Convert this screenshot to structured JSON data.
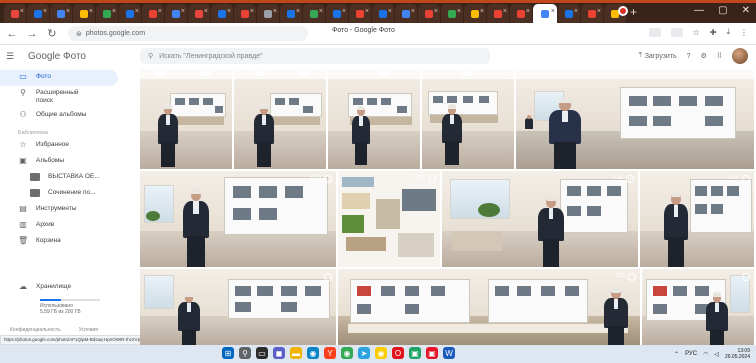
{
  "browser": {
    "tab_count": 27,
    "active_tab_index": 23,
    "tab_favicon_colors": [
      "#e8453c",
      "#1a73e8",
      "#4285f4",
      "#fbbc04",
      "#34a853",
      "#1a73e8",
      "#ea4335",
      "#4285f4",
      "#e8453c",
      "#1a73e8",
      "#ea4335",
      "#9aa0a6",
      "#1a73e8",
      "#34a853",
      "#1a73e8",
      "#ea4335",
      "#1a73e8",
      "#4285f4",
      "#ea4335",
      "#34a853",
      "#fbbc04",
      "#ea4335",
      "#ea4335",
      "#ffffff",
      "#1a73e8",
      "#ea4335",
      "#fbbc04"
    ],
    "url": "photos.google.com",
    "page_title": "Фото - Google Фото",
    "nav": {
      "back_icon": "arrow-left-icon",
      "forward_icon": "arrow-right-icon",
      "reload_icon": "reload-icon"
    },
    "status_url": "https://photos.google.com/photo/AF1QipM-Bdsaq-HpnOWtR-Ihz2VpkWfv2nPfa"
  },
  "app": {
    "logo_text": "Google Фото",
    "search_placeholder": "Искать \"Ленинградской правде\"",
    "upload_label": "Загрузить",
    "accent_color": "#1a73e8",
    "active_bg": "#e8f0fe"
  },
  "sidebar": {
    "items": [
      {
        "icon": "photo-icon",
        "label": "Фото",
        "active": true
      },
      {
        "icon": "search-icon",
        "label": "Расширенный поиск",
        "active": false
      },
      {
        "icon": "people-icon",
        "label": "Общие альбомы",
        "active": false
      }
    ],
    "section_label": "Библиотека",
    "library": [
      {
        "icon": "star-icon",
        "label": "Избранное"
      },
      {
        "icon": "album-icon",
        "label": "Альбомы"
      }
    ],
    "albums": [
      {
        "label": "ВЫСТАВКА ОЕ..."
      },
      {
        "label": "Сочинение по..."
      }
    ],
    "tools": [
      {
        "icon": "tools-icon",
        "label": "Инструменты"
      },
      {
        "icon": "archive-icon",
        "label": "Архив"
      },
      {
        "icon": "trash-icon",
        "label": "Корзина"
      }
    ],
    "storage": {
      "label": "Хранилище",
      "used_text": "Использовано",
      "detail": "5,59 ГБ из 200 ГБ"
    },
    "footer": [
      "Конфиденциальность",
      "Условия"
    ]
  },
  "photos": [
    {
      "row": 0,
      "kind": "hall-a",
      "has_man": true
    },
    {
      "row": 0,
      "kind": "hall-a",
      "has_man": true
    },
    {
      "row": 0,
      "kind": "hall-a",
      "has_man": true
    },
    {
      "row": 0,
      "kind": "hall-a",
      "has_man": true
    },
    {
      "row": 0,
      "kind": "hall-b",
      "has_man": true
    },
    {
      "row": 1,
      "kind": "hall-c",
      "has_man": true
    },
    {
      "row": 1,
      "kind": "hall-d",
      "has_man": false
    },
    {
      "row": 1,
      "kind": "hall-e",
      "has_man": true
    },
    {
      "row": 1,
      "kind": "hall-f",
      "has_man": true
    },
    {
      "row": 2,
      "kind": "hall-g",
      "has_man": true
    },
    {
      "row": 2,
      "kind": "hall-h",
      "has_man": false
    },
    {
      "row": 2,
      "kind": "hall-i",
      "has_man": true
    },
    {
      "row": 2,
      "kind": "hall-j",
      "has_man": true
    }
  ],
  "video_durations": [
    "0:05",
    "0:46",
    "0:30",
    "0:06",
    "0:35"
  ],
  "taskbar": {
    "icons": [
      {
        "name": "windows-start-icon",
        "color": "#0067c0",
        "glyph": "⊞"
      },
      {
        "name": "search-icon",
        "color": "#5f6368",
        "glyph": "⚲"
      },
      {
        "name": "taskview-icon",
        "color": "#2b2b2b",
        "glyph": "▭"
      },
      {
        "name": "chat-icon",
        "color": "#5b5fc7",
        "glyph": "◼"
      },
      {
        "name": "explorer-icon",
        "color": "#f0b400",
        "glyph": "▬"
      },
      {
        "name": "edge-icon",
        "color": "#0a84c7",
        "glyph": "◉"
      },
      {
        "name": "yandex-icon",
        "color": "#fc3f1d",
        "glyph": "Y"
      },
      {
        "name": "chrome-icon",
        "color": "#34a853",
        "glyph": "◉"
      },
      {
        "name": "telegram-icon",
        "color": "#2aa3df",
        "glyph": "➤"
      },
      {
        "name": "yandex-browser-icon",
        "color": "#ffcc00",
        "glyph": "◉"
      },
      {
        "name": "opera-icon",
        "color": "#e3131b",
        "glyph": "O"
      },
      {
        "name": "green-app-icon",
        "color": "#21a366",
        "glyph": "▣"
      },
      {
        "name": "red-app-icon",
        "color": "#e81123",
        "glyph": "▣"
      },
      {
        "name": "word-icon",
        "color": "#185abd",
        "glyph": "W"
      }
    ],
    "tray_text": "РУС",
    "time": "13:09",
    "date": "26.05.2024"
  }
}
